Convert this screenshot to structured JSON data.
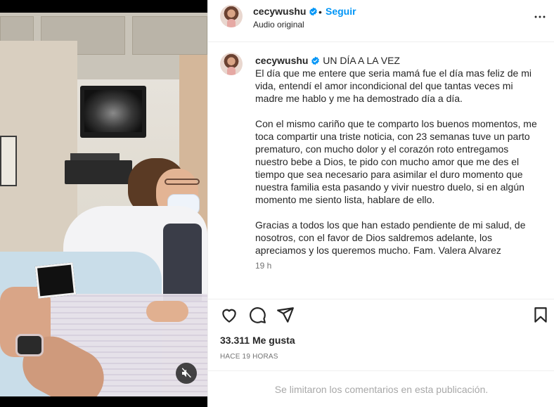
{
  "post": {
    "username": "cecywushu",
    "follow_label": "Seguir",
    "audio_label": "Audio original",
    "caption_title": "UN DÍA A LA VEZ",
    "caption_paragraphs": [
      "El día que me entere que seria mamá fue el día mas feliz de mi vida, entendí el amor incondicional del que tantas veces mi madre me hablo y me ha demostrado día a día.",
      "Con el mismo cariño que te comparto los buenos momentos, me toca compartir una triste noticia, con 23 semanas tuve un parto prematuro, con mucho dolor y el corazón roto entregamos nuestro bebe a Dios, te pido con mucho amor que me des el tiempo que sea necesario para asimilar el duro momento que nuestra familia esta pasando y vivir nuestro duelo, si en algún momento me siento lista, hablare de ello.",
      "Gracias a todos los que han estado pendiente de mi salud, de nosotros, con el favor de Dios saldremos adelante, los apreciamos y los queremos mucho. Fam. Valera Alvarez"
    ],
    "caption_time": "19 h",
    "next_comment_preview": "",
    "likes": "33.311 Me gusta",
    "posted_ago": "HACE 19 HORAS",
    "comments_limited": "Se limitaron los comentarios en esta publicación."
  },
  "icons": {
    "verified": "verified-badge-icon",
    "more": "more-options-icon",
    "like": "heart-icon",
    "comment": "comment-icon",
    "share": "share-icon",
    "save": "bookmark-icon",
    "mute": "mute-icon"
  },
  "colors": {
    "accent": "#0095f6",
    "text": "#262626",
    "secondary": "#737373",
    "disabled": "#a8a8a8"
  }
}
